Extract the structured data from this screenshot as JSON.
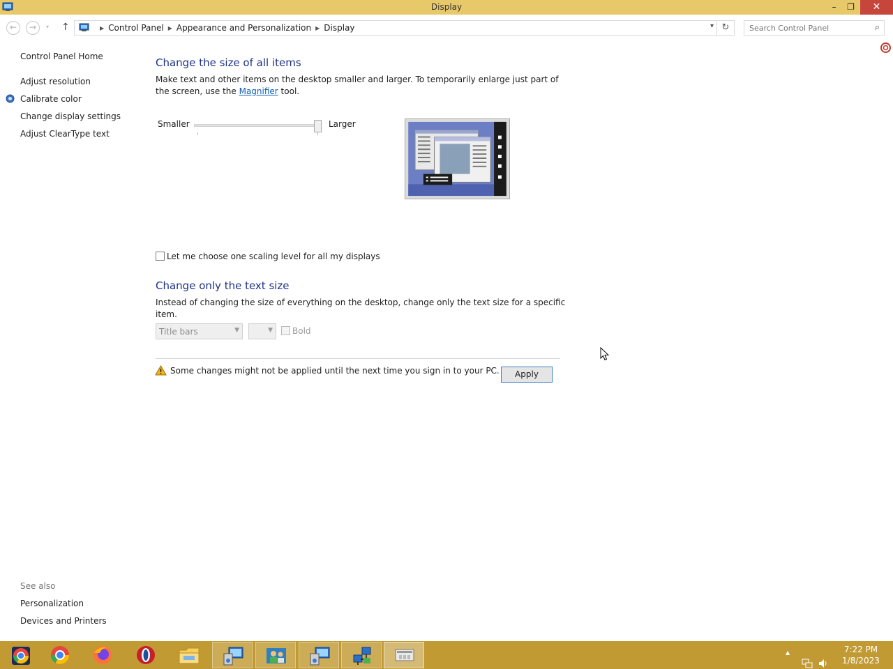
{
  "window": {
    "title": "Display",
    "minimize": "–",
    "maximize": "❐",
    "close": "✕"
  },
  "address_bar": {
    "back_icon": "←",
    "forward_icon": "→",
    "up_icon": "↑",
    "refresh_icon": "↻",
    "dropdown_icon": "▾",
    "breadcrumbs": [
      "Control Panel",
      "Appearance and Personalization",
      "Display"
    ],
    "search_placeholder": "Search Control Panel",
    "search_icon": "⌕"
  },
  "sidebar": {
    "home": "Control Panel Home",
    "items": [
      "Adjust resolution",
      "Calibrate color",
      "Change display settings",
      "Adjust ClearType text"
    ],
    "see_also_heading": "See also",
    "see_also": [
      "Personalization",
      "Devices and Printers"
    ]
  },
  "main": {
    "size_section": {
      "heading": "Change the size of all items",
      "desc_before_link": "Make text and other items on the desktop smaller and larger. To temporarily enlarge just part of the screen, use the ",
      "link_text": "Magnifier",
      "desc_after_link": " tool.",
      "slider_min_label": "Smaller",
      "slider_max_label": "Larger",
      "slider_level": 1.0
    },
    "scaling_checkbox": {
      "label": "Let me choose one scaling level for all my displays",
      "checked": false
    },
    "text_section": {
      "heading": "Change only the text size",
      "desc": "Instead of changing the size of everything on the desktop, change only the text size for a specific item.",
      "item_select_value": "Title bars",
      "size_select_value": "",
      "bold_label": "Bold",
      "bold_checked": false
    },
    "warning": "Some changes might not be applied until the next time you sign in to your PC.",
    "apply_label": "Apply"
  },
  "taskbar": {
    "apps": [
      "chrome-alt-icon",
      "chrome-icon",
      "firefox-icon",
      "opera-icon",
      "file-explorer-icon",
      "control-panel-icon",
      "users-icon",
      "control-panel-icon",
      "network-icon",
      "display-icon"
    ],
    "time": "7:22 PM",
    "date": "1/8/2023",
    "tray_expand": "▲"
  },
  "colors": {
    "title_bar": "#e8c96a",
    "taskbar": "#c29a34",
    "heading": "#1e3287",
    "link": "#0a5fb4",
    "close_button": "#c7463c"
  }
}
